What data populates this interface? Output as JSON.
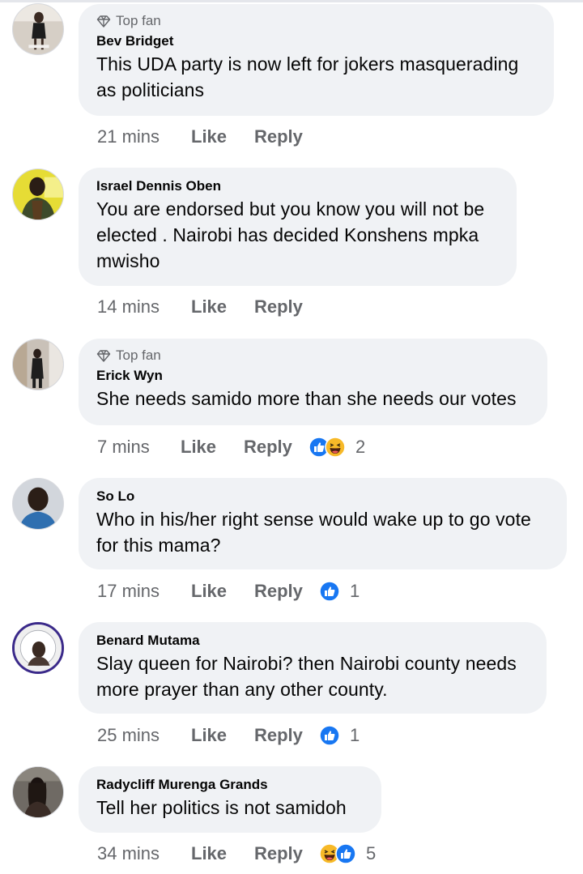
{
  "labels": {
    "top_fan": "Top fan",
    "like": "Like",
    "reply": "Reply"
  },
  "colors": {
    "bubble": "#f0f2f5",
    "meta_text": "#65676b",
    "like_blue": "#1877f2",
    "haha_yellow": "#f7b928"
  },
  "comments": [
    {
      "name": "Bev Bridget",
      "badge": "Top fan",
      "text_lines": [
        "This UDA party is now left for jokers masquerading",
        "as politicians"
      ],
      "time": "21 mins",
      "reactions": [],
      "reaction_count": ""
    },
    {
      "name": "Israel Dennis Oben",
      "badge": "",
      "text_lines": [
        "You are endorsed but you know you will not be",
        "elected . Nairobi has decided Konshens mpka",
        "mwisho"
      ],
      "time": "14 mins",
      "reactions": [],
      "reaction_count": ""
    },
    {
      "name": "Erick Wyn",
      "badge": "Top fan",
      "text_lines": [
        "She needs samido more than she needs our votes"
      ],
      "time": "7 mins",
      "reactions": [
        "like-icon",
        "haha-icon"
      ],
      "reaction_count": "2"
    },
    {
      "name": "So Lo",
      "badge": "",
      "text_lines": [
        "Who in his/her right sense would wake up to go vote",
        "for this mama?"
      ],
      "time": "17 mins",
      "reactions": [
        "like-icon"
      ],
      "reaction_count": "1"
    },
    {
      "name": "Benard Mutama",
      "badge": "",
      "text_lines": [
        "Slay queen for Nairobi? then Nairobi county needs",
        "more prayer than any other county."
      ],
      "time": "25 mins",
      "reactions": [
        "like-icon"
      ],
      "reaction_count": "1"
    },
    {
      "name": "Radycliff Murenga Grands",
      "badge": "",
      "text_lines": [
        "Tell her politics is not samidoh"
      ],
      "time": "34 mins",
      "reactions": [
        "haha-icon",
        "like-icon"
      ],
      "reaction_count": "5"
    }
  ]
}
